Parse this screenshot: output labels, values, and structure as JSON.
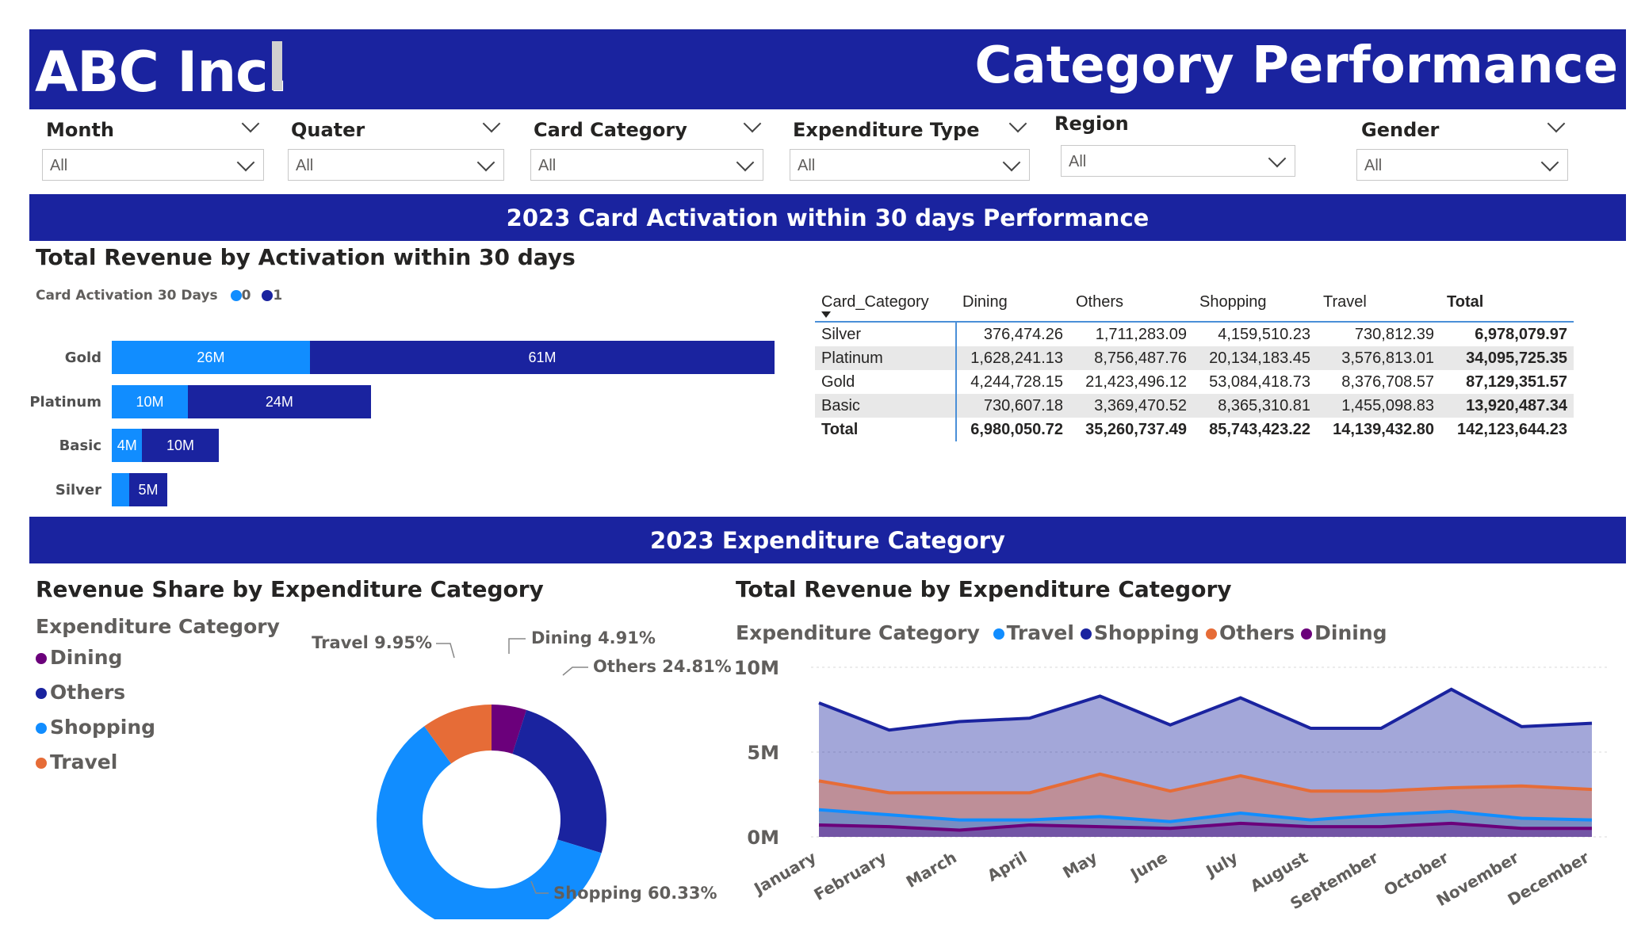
{
  "header": {
    "company": "ABC Inc.",
    "title": "Category Performance"
  },
  "filters": [
    {
      "label": "Month",
      "value": "All"
    },
    {
      "label": "Quater",
      "value": "All"
    },
    {
      "label": "Card Category",
      "value": "All"
    },
    {
      "label": "Expenditure Type",
      "value": "All"
    },
    {
      "label": "Region",
      "value": "All"
    },
    {
      "label": "Gender",
      "value": "All"
    }
  ],
  "section1": {
    "band": "2023 Card Activation within 30 days Performance"
  },
  "bar_chart": {
    "title": "Total Revenue by Activation within 30 days",
    "legend_title": "Card Activation 30 Days",
    "legend": [
      "0",
      "1"
    ],
    "colors": [
      "#118dff",
      "#1a239f"
    ]
  },
  "matrix": {
    "columns": [
      "Card_Category",
      "Dining",
      "Others",
      "Shopping",
      "Travel",
      "Total"
    ],
    "rows": [
      [
        "Silver",
        "376,474.26",
        "1,711,283.09",
        "4,159,510.23",
        "730,812.39",
        "6,978,079.97"
      ],
      [
        "Platinum",
        "1,628,241.13",
        "8,756,487.76",
        "20,134,183.45",
        "3,576,813.01",
        "34,095,725.35"
      ],
      [
        "Gold",
        "4,244,728.15",
        "21,423,496.12",
        "53,084,418.73",
        "8,376,708.57",
        "87,129,351.57"
      ],
      [
        "Basic",
        "730,607.18",
        "3,369,470.52",
        "8,365,310.81",
        "1,455,098.83",
        "13,920,487.34"
      ]
    ],
    "total": [
      "Total",
      "6,980,050.72",
      "35,260,737.49",
      "85,743,423.22",
      "14,139,432.80",
      "142,123,644.23"
    ]
  },
  "section2": {
    "band": "2023 Expenditure Category"
  },
  "donut": {
    "title": "Revenue Share by Expenditure Category",
    "legend_title": "Expenditure Category",
    "legend": [
      "Dining",
      "Others",
      "Shopping",
      "Travel"
    ],
    "labels": {
      "dining": "Dining 4.91%",
      "others": "Others 24.81%",
      "shopping": "Shopping 60.33%",
      "travel": "Travel 9.95%"
    }
  },
  "area": {
    "title": "Total Revenue by Expenditure Category",
    "legend_title": "Expenditure Category",
    "legend": [
      "Travel",
      "Shopping",
      "Others",
      "Dining"
    ],
    "yticks": [
      "10M",
      "5M",
      "0M"
    ]
  },
  "chart_data": [
    {
      "type": "bar",
      "title": "Total Revenue by Activation within 30 days",
      "categories": [
        "Gold",
        "Platinum",
        "Basic",
        "Silver"
      ],
      "series": [
        {
          "name": "0",
          "values": [
            26,
            10,
            4,
            1
          ],
          "labels": [
            "26M",
            "10M",
            "4M",
            ""
          ]
        },
        {
          "name": "1",
          "values": [
            61,
            24,
            10,
            5
          ],
          "labels": [
            "61M",
            "24M",
            "10M",
            "5M"
          ]
        }
      ],
      "unit": "M"
    },
    {
      "type": "pie",
      "title": "Revenue Share by Expenditure Category",
      "categories": [
        "Dining",
        "Others",
        "Shopping",
        "Travel"
      ],
      "values": [
        4.91,
        24.81,
        60.33,
        9.95
      ],
      "colors": [
        "#6b007b",
        "#1a239f",
        "#118dff",
        "#e66c37"
      ]
    },
    {
      "type": "area",
      "title": "Total Revenue by Expenditure Category",
      "categories": [
        "January",
        "February",
        "March",
        "April",
        "May",
        "June",
        "July",
        "August",
        "September",
        "October",
        "November",
        "December"
      ],
      "ylim": [
        0,
        10
      ],
      "series": [
        {
          "name": "Shopping",
          "color": "#1a239f",
          "values": [
            7.9,
            6.3,
            6.8,
            7.0,
            8.3,
            6.6,
            8.2,
            6.4,
            6.4,
            8.7,
            6.5,
            6.7
          ]
        },
        {
          "name": "Others",
          "color": "#e66c37",
          "values": [
            3.3,
            2.6,
            2.6,
            2.6,
            3.7,
            2.7,
            3.6,
            2.7,
            2.7,
            2.9,
            3.0,
            2.8
          ]
        },
        {
          "name": "Travel",
          "color": "#118dff",
          "values": [
            1.6,
            1.3,
            1.0,
            1.0,
            1.2,
            0.9,
            1.4,
            1.0,
            1.3,
            1.5,
            1.1,
            1.0
          ]
        },
        {
          "name": "Dining",
          "color": "#6b007b",
          "values": [
            0.7,
            0.6,
            0.4,
            0.7,
            0.6,
            0.5,
            0.8,
            0.6,
            0.6,
            0.8,
            0.5,
            0.5
          ]
        }
      ]
    }
  ]
}
